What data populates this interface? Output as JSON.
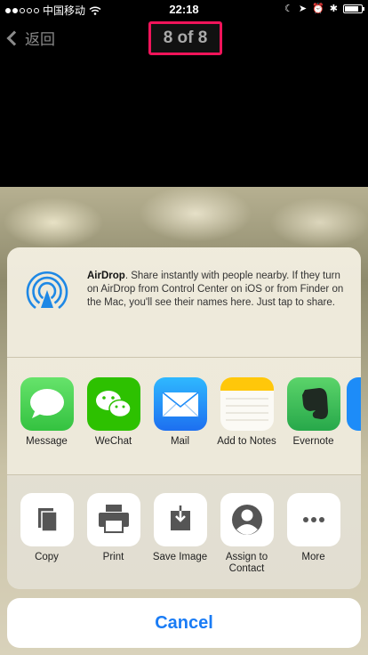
{
  "status_bar": {
    "carrier": "中国移动",
    "time": "22:18",
    "battery_level": 0.85
  },
  "nav": {
    "back_label": "返回",
    "counter": "8 of 8"
  },
  "airdrop": {
    "title": "AirDrop",
    "description": ". Share instantly with people nearby. If they turn on AirDrop from Control Center on iOS or from Finder on the Mac, you'll see their names here. Just tap to share."
  },
  "apps": [
    {
      "label": "Message",
      "icon": "message-icon",
      "color": "#4cd964"
    },
    {
      "label": "WeChat",
      "icon": "wechat-icon",
      "color": "#2dc100"
    },
    {
      "label": "Mail",
      "icon": "mail-icon",
      "color": "#1d8cf8"
    },
    {
      "label": "Add to Notes",
      "icon": "notes-icon",
      "color": "#ffd60a"
    },
    {
      "label": "Evernote",
      "icon": "evernote-icon",
      "color": "#2dbe60"
    }
  ],
  "actions": [
    {
      "label": "Copy",
      "icon": "copy-icon"
    },
    {
      "label": "Print",
      "icon": "print-icon"
    },
    {
      "label": "Save Image",
      "icon": "save-image-icon"
    },
    {
      "label": "Assign to Contact",
      "icon": "contact-icon"
    },
    {
      "label": "More",
      "icon": "more-icon"
    }
  ],
  "cancel_label": "Cancel",
  "colors": {
    "accent": "#1a7cf5",
    "highlight": "#f0145a"
  }
}
